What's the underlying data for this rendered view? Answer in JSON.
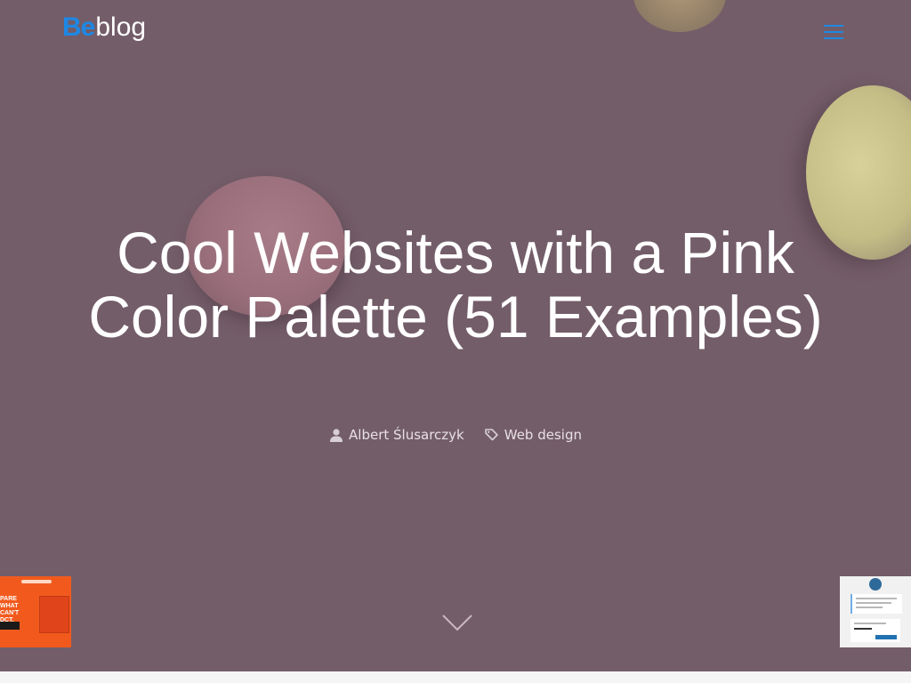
{
  "header": {
    "logo_be": "Be",
    "logo_blog": "blog"
  },
  "hero": {
    "title": "Cool Websites with a Pink Color Palette (51 Examples)",
    "author": "Albert Ślusarczyk",
    "category": "Web design"
  },
  "icons": {
    "menu": "hamburger-menu-icon",
    "author": "user-icon",
    "category": "tag-icon",
    "scroll": "chevron-down-icon"
  },
  "colors": {
    "brand_blue": "#1e88e5",
    "overlay": "#735d68",
    "title_text": "#ffffff"
  }
}
